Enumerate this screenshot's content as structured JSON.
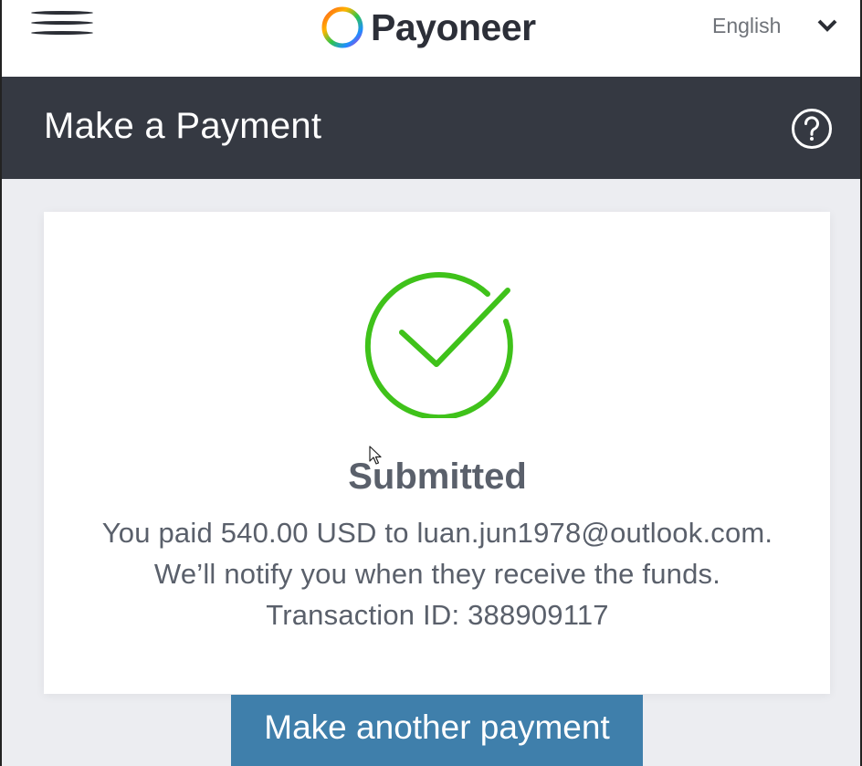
{
  "topbar": {
    "menu_icon": "hamburger-menu-icon",
    "brand": "Payoneer",
    "logo_icon": "payoneer-ring-logo",
    "language": {
      "selected": "English",
      "icon": "chevron-down-icon"
    }
  },
  "header": {
    "title": "Make a Payment",
    "help_icon": "question-circle-icon"
  },
  "result": {
    "icon": "check-circle-icon",
    "status": "Submitted",
    "line1": "You paid 540.00 USD to luan.jun1978@outlook.com.",
    "line2": "We’ll notify you when they receive the funds.",
    "line3": "Transaction ID: 388909117"
  },
  "actions": {
    "make_another_label": "Make another payment"
  },
  "colors": {
    "header_bg": "#353942",
    "success_green": "#3fc21a",
    "button_blue": "#3f7fab",
    "page_bg": "#ecedf1",
    "text_gray": "#5a606b"
  }
}
